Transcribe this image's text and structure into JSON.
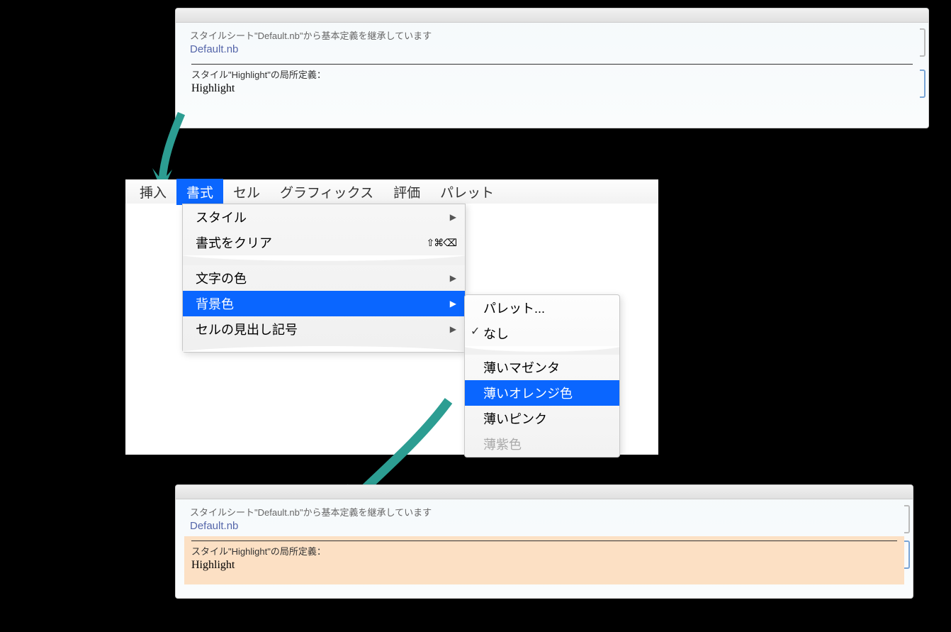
{
  "panel1": {
    "inherit_text": "スタイルシート\"Default.nb\"から基本定義を継承しています",
    "default_link": "Default.nb",
    "style_def_label": "スタイル\"Highlight\"の局所定義：",
    "style_name": "Highlight"
  },
  "panel2": {
    "inherit_text": "スタイルシート\"Default.nb\"から基本定義を継承しています",
    "default_link": "Default.nb",
    "style_def_label": "スタイル\"Highlight\"の局所定義：",
    "style_name": "Highlight"
  },
  "menubar": {
    "insert": "挿入",
    "format": "書式",
    "cell": "セル",
    "graphics": "グラフィックス",
    "evaluation": "評価",
    "palettes": "パレット"
  },
  "dropdown": {
    "style": "スタイル",
    "clear_format": "書式をクリア",
    "clear_shortcut": "⇧⌘⌫",
    "text_color": "文字の色",
    "bg_color": "背景色",
    "cell_dingbat": "セルの見出し記号"
  },
  "submenu": {
    "palette": "パレット...",
    "none": "なし",
    "light_magenta": "薄いマゼンタ",
    "light_orange": "薄いオレンジ色",
    "light_pink": "薄いピンク",
    "light_purple": "薄紫色"
  }
}
